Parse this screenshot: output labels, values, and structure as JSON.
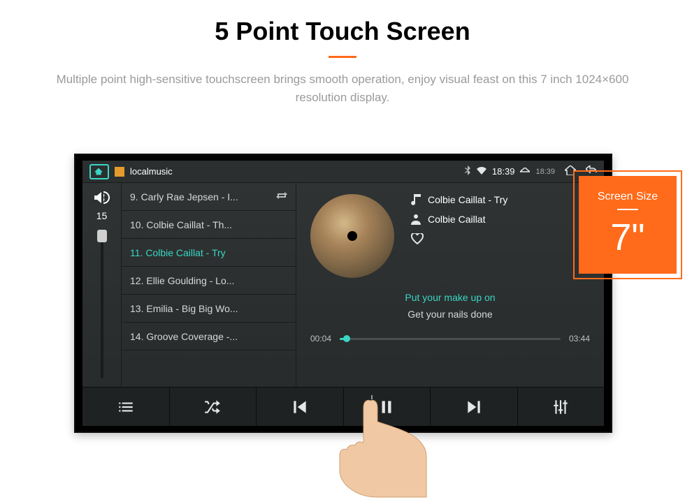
{
  "header": {
    "title": "5 Point Touch Screen",
    "subtitle": "Multiple point high-sensitive touchscreen brings smooth operation, enjoy visual feast on this 7 inch 1024×600 resolution display."
  },
  "status": {
    "section": "localmusic",
    "time1": "18:39",
    "time2": "18:39"
  },
  "volume": {
    "value": "15"
  },
  "playlist": [
    {
      "label": "9. Carly Rae Jepsen - I...",
      "active": false,
      "repeat": true
    },
    {
      "label": "10. Colbie Caillat - Th...",
      "active": false,
      "repeat": false
    },
    {
      "label": "11. Colbie Caillat - Try",
      "active": true,
      "repeat": false
    },
    {
      "label": "12. Ellie Goulding - Lo...",
      "active": false,
      "repeat": false
    },
    {
      "label": "13. Emilia - Big Big Wo...",
      "active": false,
      "repeat": false
    },
    {
      "label": "14. Groove Coverage -...",
      "active": false,
      "repeat": false
    }
  ],
  "now_playing": {
    "song": "Colbie Caillat - Try",
    "artist": "Colbie Caillat",
    "lyrics_current": "Put your make up on",
    "lyrics_next": "Get your nails done",
    "elapsed": "00:04",
    "duration": "03:44"
  },
  "controls": {
    "list": "Playlist",
    "shuffle": "Shuffle",
    "prev": "Previous",
    "play": "Pause",
    "next": "Next",
    "eq": "Equalizer"
  },
  "badge": {
    "label": "Screen Size",
    "size": "7\""
  }
}
